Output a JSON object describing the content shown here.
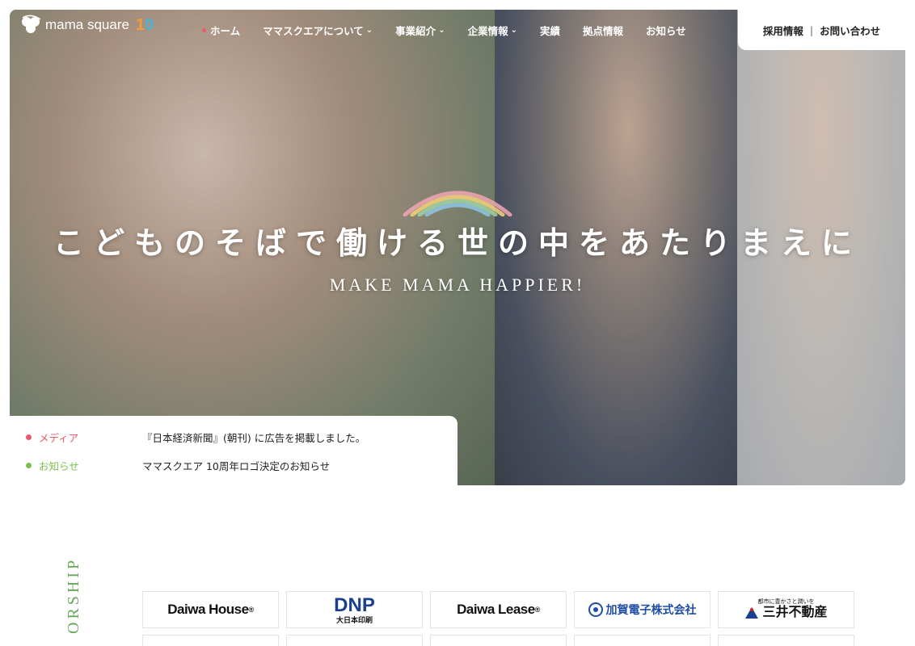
{
  "header": {
    "logo_text": "mama square",
    "logo_badge": "10",
    "nav": [
      {
        "label": "ホーム",
        "active": true,
        "dropdown": false
      },
      {
        "label": "ママスクエアについて",
        "active": false,
        "dropdown": true
      },
      {
        "label": "事業紹介",
        "active": false,
        "dropdown": true
      },
      {
        "label": "企業情報",
        "active": false,
        "dropdown": true
      },
      {
        "label": "実績",
        "active": false,
        "dropdown": false
      },
      {
        "label": "拠点情報",
        "active": false,
        "dropdown": false
      },
      {
        "label": "お知らせ",
        "active": false,
        "dropdown": false
      }
    ],
    "utility": {
      "recruit": "採用情報",
      "separator": "|",
      "contact": "お問い合わせ"
    }
  },
  "hero": {
    "headline": "こどものそばで働ける世の中をあたりまえに",
    "subline": "MAKE MAMA HAPPIER!"
  },
  "news": [
    {
      "category": "メディア",
      "color": "#e85a6a",
      "title": "『日本経済新聞』(朝刊) に広告を掲載しました。"
    },
    {
      "category": "お知らせ",
      "color": "#7cc04b",
      "title": "ママスクエア 10周年ロゴ決定のお知らせ"
    }
  ],
  "partnership": {
    "section_title": "ORSHIP",
    "logos_row1": [
      {
        "name": "Daiwa House",
        "mark": "®"
      },
      {
        "name": "DNP",
        "sub": "大日本印刷"
      },
      {
        "name": "Daiwa Lease",
        "mark": "®"
      },
      {
        "name": "加賀電子株式会社"
      },
      {
        "name": "三井不動産",
        "sub": "都市に豊かさと潤いを"
      }
    ]
  },
  "colors": {
    "accent_red": "#e85a6a",
    "accent_green": "#7cc04b",
    "partnership_green": "#6aa85a"
  }
}
